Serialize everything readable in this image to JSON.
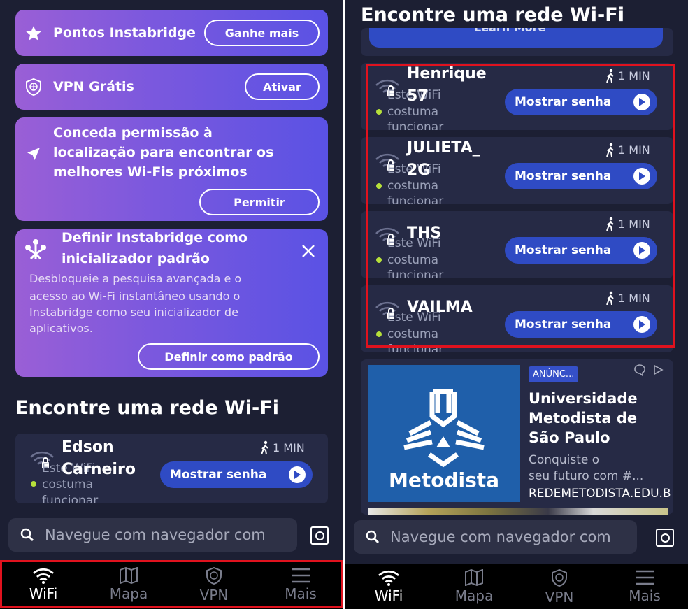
{
  "left": {
    "points_card": {
      "title": "Pontos Instabridge",
      "button": "Ganhe mais"
    },
    "vpn_card": {
      "title": "VPN Grátis",
      "button": "Ativar"
    },
    "location_card": {
      "line1": "Conceda permissão à",
      "line2": "localização para encontrar os",
      "line3": "melhores Wi-Fis próximos",
      "button": "Permitir"
    },
    "launcher_card": {
      "title1": "Definir Instabridge como",
      "title2": "inicializador padrão",
      "body1": "Desbloqueie a pesquisa avançada e o",
      "body2": "acesso ao Wi-Fi instantâneo usando o",
      "body3": "Instabridge como seu inicializador de",
      "body4": "aplicativos.",
      "button": "Definir como padrão"
    },
    "section_title": "Encontre uma rede Wi-Fi",
    "network": {
      "name1": "Edson",
      "name2": "Carneiro",
      "sub1": "Este WiFi",
      "sub2": "costuma",
      "sub3": "funcionar",
      "time": "1 MIN",
      "button": "Mostrar senha"
    },
    "search_placeholder": "Navegue com navegador com",
    "nav": {
      "wifi": "WiFi",
      "map": "Mapa",
      "vpn": "VPN",
      "more": "Mais"
    }
  },
  "right": {
    "section_title": "Encontre uma rede Wi-Fi",
    "partial_button": "Learn More",
    "networks": [
      {
        "name1": "Henrique",
        "name2": "57",
        "sub1": "Este WiFi",
        "sub2": "costuma",
        "sub3": "funcionar",
        "time": "1 MIN",
        "button": "Mostrar senha"
      },
      {
        "name1": "JULIETA_",
        "name2": "2G",
        "sub1": "Este WiFi",
        "sub2": "costuma",
        "sub3": "funcionar",
        "time": "1 MIN",
        "button": "Mostrar senha"
      },
      {
        "name1": "THS",
        "name2": "",
        "sub1": "Este WiFi",
        "sub2": "costuma",
        "sub3": "funcionar",
        "time": "1 MIN",
        "button": "Mostrar senha"
      },
      {
        "name1": "VAILMA",
        "name2": "",
        "sub1": "Este WiFi",
        "sub2": "costuma",
        "sub3": "funcionar",
        "time": "1 MIN",
        "button": "Mostrar senha"
      }
    ],
    "ad": {
      "badge": "ANÚNC...",
      "logo_text": "Metodista",
      "title1": "Universidade",
      "title2": "Metodista de",
      "title3": "São Paulo",
      "text1": "Conquiste o",
      "text2": "seu futuro com #...",
      "url": "REDEMETODISTA.EDU.BR"
    },
    "search_placeholder": "Navegue com navegador com",
    "nav": {
      "wifi": "WiFi",
      "map": "Mapa",
      "vpn": "VPN",
      "more": "Mais"
    }
  },
  "colors": {
    "background": "#1c1f33",
    "accent": "#2f4bc4",
    "highlight": "#e0121e",
    "status_dot": "#b6e03a"
  },
  "icons": [
    "star-icon",
    "shield-icon",
    "location-arrow-icon",
    "launcher-icon",
    "close-icon",
    "wifi-lock-icon",
    "walk-icon",
    "play-icon",
    "search-icon",
    "camera-icon",
    "wifi-icon",
    "map-icon",
    "vpn-shield-icon",
    "menu-icon"
  ]
}
